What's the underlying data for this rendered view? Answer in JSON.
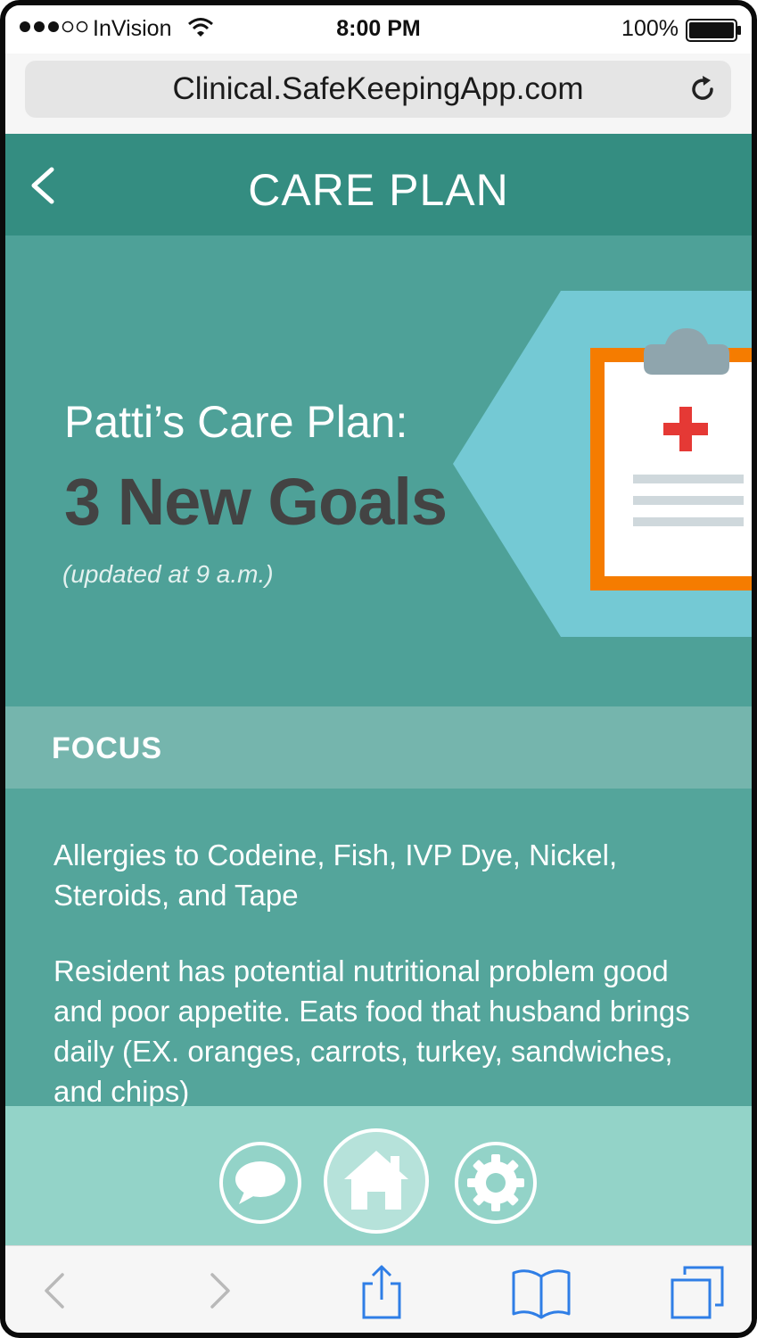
{
  "status_bar": {
    "carrier": "InVision",
    "time": "8:00 PM",
    "battery": "100%"
  },
  "browser": {
    "url": "Clinical.SafeKeepingApp.com"
  },
  "header": {
    "title": "CARE PLAN"
  },
  "hero": {
    "subtitle": "Patti’s Care Plan:",
    "title": "3 New Goals",
    "updated": "(updated at 9 a.m.)"
  },
  "focus": {
    "label": "FOCUS",
    "items": [
      "Allergies to Codeine, Fish, IVP Dye, Nickel, Steroids, and Tape",
      "Resident has potential nutritional problem good and poor appetite. Eats food that husband brings daily (EX. oranges, carrots, turkey, sandwiches, and chips)"
    ]
  },
  "colors": {
    "header": "#348d81",
    "hero": "#4ea198",
    "focus_bar": "#75b5ad",
    "content": "#54a59b",
    "bottom_nav": "#93d3c8",
    "clipboard_orange": "#f57c00",
    "cross_red": "#e53935",
    "toolbar_blue": "#2f7ee6"
  },
  "icons": {
    "back": "chevron-left-icon",
    "reload": "reload-icon",
    "chat": "chat-bubble-icon",
    "home": "home-icon",
    "settings": "gear-icon",
    "clipboard": "clipboard-icon",
    "share": "share-icon",
    "bookmarks": "bookmarks-icon",
    "tabs": "tabs-icon"
  }
}
